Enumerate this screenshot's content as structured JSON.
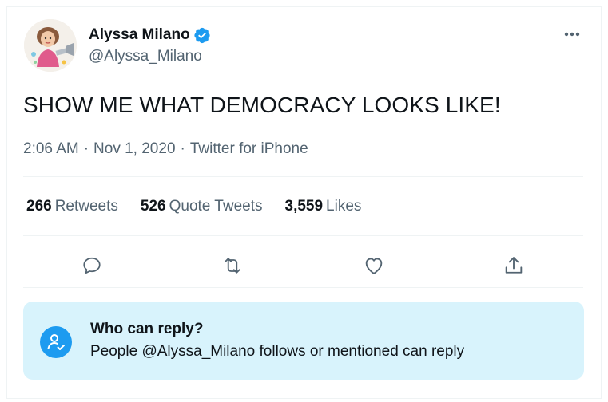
{
  "tweet": {
    "author": {
      "display_name": "Alyssa Milano",
      "handle": "@Alyssa_Milano",
      "verified": true
    },
    "text": "SHOW ME WHAT DEMOCRACY LOOKS LIKE!",
    "meta": {
      "time": "2:06 AM",
      "date": "Nov 1, 2020",
      "source": "Twitter for iPhone",
      "separator": "·"
    },
    "stats": [
      {
        "count": "266",
        "label": "Retweets"
      },
      {
        "count": "526",
        "label": "Quote Tweets"
      },
      {
        "count": "3,559",
        "label": "Likes"
      }
    ],
    "actions": [
      "reply",
      "retweet",
      "like",
      "share"
    ],
    "who_can_reply": {
      "title": "Who can reply?",
      "body": "People @Alyssa_Milano follows or mentioned can reply"
    }
  },
  "colors": {
    "accent": "#1d9bf0",
    "text_primary": "#0f1419",
    "text_secondary": "#536471",
    "divider": "#eff3f4",
    "reply_box_bg": "#d8f3fc"
  }
}
